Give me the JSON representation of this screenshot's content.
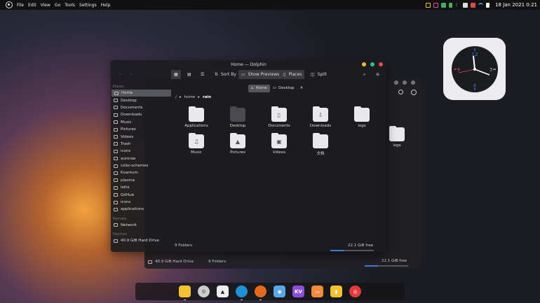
{
  "topbar": {
    "menu": [
      "File",
      "Edit",
      "View",
      "Go",
      "Tools",
      "Settings",
      "Help"
    ],
    "datetime": "18 Jan 2021",
    "time": "0:21"
  },
  "window": {
    "title": "Home — Dolphin"
  },
  "toolbar": {
    "sort_by": "Sort By",
    "show_previews": "Show Previews",
    "places": "Places",
    "split": "Split"
  },
  "sidebar": {
    "places_header": "Places",
    "items": [
      "Home",
      "Desktop",
      "Documents",
      "Downloads",
      "Music",
      "Pictures",
      "Videos",
      "Trash",
      "icons",
      "aurorae",
      "color-schemes",
      "Kvantum",
      "plasma",
      "latte",
      "GitHub",
      "icons",
      "applications"
    ],
    "remote_header": "Remote",
    "network": "Network",
    "devices_header": "Devices",
    "drive": "40.9 GiB Hard Drive"
  },
  "tabs": [
    "Home",
    "Desktop"
  ],
  "breadcrumb": {
    "root": "/",
    "home": "home",
    "user": "rain"
  },
  "files": [
    "Applications",
    "Desktop",
    "Documents",
    "Downloads",
    "logs",
    "Music",
    "Pictures",
    "Videos",
    "文档"
  ],
  "status": {
    "folders": "9 Folders",
    "free": "22.1 GiB free",
    "free_fraction": 0.3
  },
  "back_window": {
    "file": "logs",
    "drive": "40.9 GiB Hard Drive",
    "folders": "9 Folders",
    "free": "22.1 GiB free"
  },
  "clock": {
    "hour12": "12",
    "hour3": "3",
    "hour6": "6",
    "hour9": "9"
  },
  "dock": {
    "apps": [
      "files",
      "settings",
      "inkscape",
      "edge",
      "firefox",
      "github",
      "kvantum",
      "store",
      "tuxedo",
      "netease"
    ],
    "kv_label": "KV"
  },
  "colors": {
    "accent": "#3d7be0",
    "close": "#e5484d",
    "minimize": "#f5b731",
    "maximize": "#2ec27e"
  }
}
